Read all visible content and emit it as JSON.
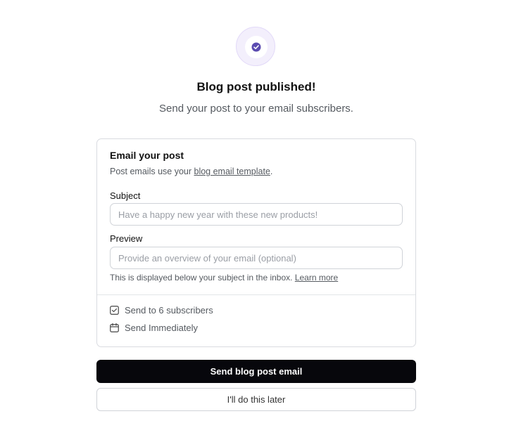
{
  "header": {
    "icon": "check-circle-icon",
    "accent_color": "#5b4bb0",
    "title": "Blog post published!",
    "subtitle": "Send your post to your email subscribers."
  },
  "card": {
    "title": "Email your post",
    "description_prefix": "Post emails use your ",
    "description_link": "blog email template",
    "description_suffix": ".",
    "subject": {
      "label": "Subject",
      "value": "",
      "placeholder": "Have a happy new year with these new products!"
    },
    "preview": {
      "label": "Preview",
      "value": "",
      "placeholder": "Provide an overview of your email (optional)"
    },
    "hint_text": "This is displayed below your subject in the inbox. ",
    "hint_link": "Learn more",
    "meta": [
      {
        "icon": "checkbox-icon",
        "label": "Send to 6 subscribers"
      },
      {
        "icon": "calendar-icon",
        "label": "Send Immediately"
      }
    ]
  },
  "actions": {
    "primary_label": "Send blog post email",
    "secondary_label": "I'll do this later"
  }
}
